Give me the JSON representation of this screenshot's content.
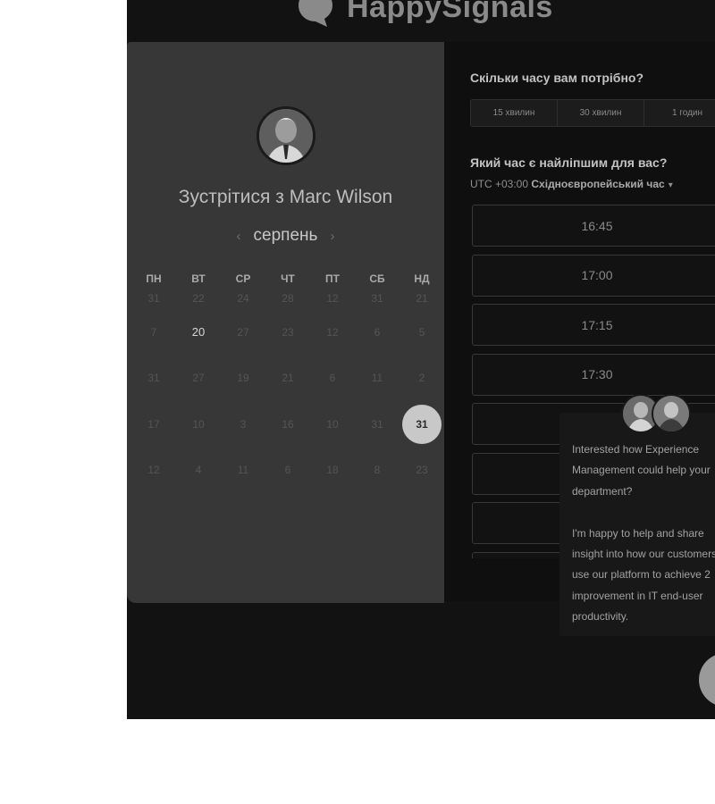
{
  "brand": {
    "name": "HappySignals"
  },
  "scheduler": {
    "title_prefix": "Зустрітися з",
    "host_name": "Marc Wilson",
    "month": "серпень",
    "weekdays": [
      "ПН",
      "ВТ",
      "СР",
      "ЧТ",
      "ПТ",
      "СБ",
      "НД"
    ],
    "weeks": [
      [
        "31",
        "22",
        "24",
        "28",
        "12",
        "31",
        "21"
      ],
      [
        "7",
        "20",
        "27",
        "23",
        "12",
        "6",
        "5"
      ],
      [
        "31",
        "27",
        "19",
        "21",
        "6",
        "11",
        "2"
      ],
      [
        "17",
        "10",
        "3",
        "16",
        "10",
        "31",
        "31"
      ],
      [
        "12",
        "4",
        "11",
        "6",
        "18",
        "8",
        "23"
      ]
    ],
    "active_days": [
      [
        1,
        1
      ]
    ],
    "selected_day": [
      3,
      6
    ]
  },
  "duration": {
    "question": "Скільки часу вам потрібно?",
    "options": [
      "15 хвилин",
      "30 хвилин",
      "1 годин"
    ]
  },
  "time": {
    "question": "Який час є найліпшим для вас?",
    "tz_offset": "UTC +03:00",
    "tz_name": "Східноєвропейський час",
    "slots": [
      "16:45",
      "17:00",
      "17:15",
      "17:30",
      "",
      "",
      "",
      ""
    ]
  },
  "chat": {
    "message_1": "Interested how Experience Management could help your department?",
    "message_2": "I'm happy to help and share insight into how our customers use our platform to achieve 2 improvement in IT end-user productivity."
  },
  "icons": {
    "logo": "happysignals-logo-icon",
    "prev": "chevron-left-icon",
    "next": "chevron-right-icon",
    "tz_caret": "caret-down-icon"
  },
  "colors": {
    "selected_day": "#c8c8c8",
    "panel_left": "#373737",
    "panel_right": "#0f0f0f"
  }
}
